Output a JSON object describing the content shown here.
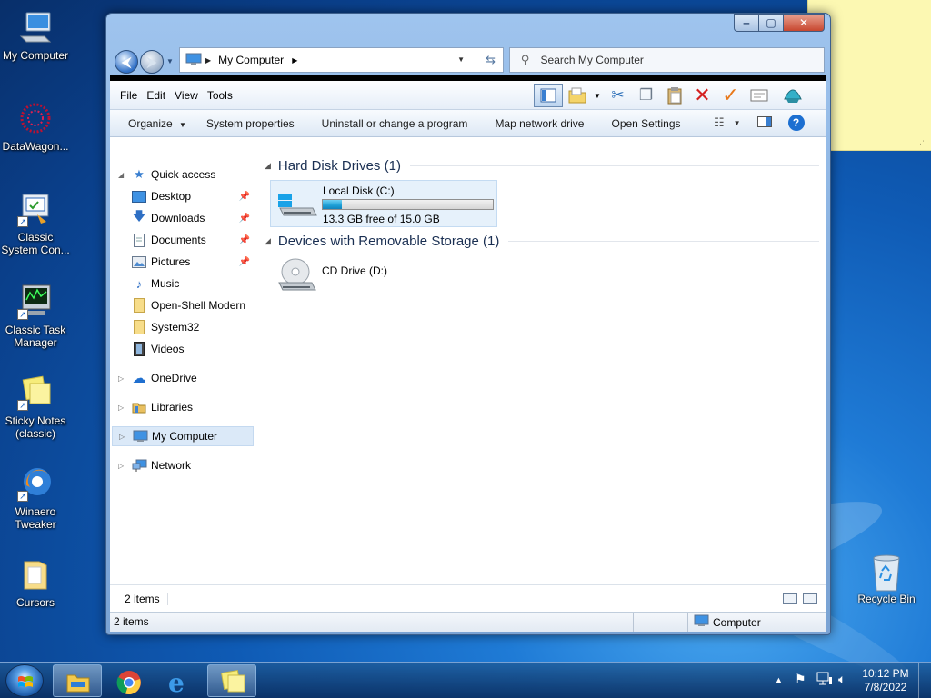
{
  "desktop": {
    "icons": [
      {
        "label": "My Computer"
      },
      {
        "label": "DataWagon..."
      },
      {
        "label": "Classic System Con..."
      },
      {
        "label": "Classic Task Manager"
      },
      {
        "label": "Sticky Notes (classic)"
      },
      {
        "label": "Winaero Tweaker"
      },
      {
        "label": "Cursors"
      },
      {
        "label": "Recycle Bin"
      }
    ]
  },
  "window": {
    "caption_buttons": {
      "minimize": "‒",
      "maximize": "▢",
      "close": "✕"
    },
    "address": {
      "location": "My Computer"
    },
    "search": {
      "placeholder": "Search My Computer"
    },
    "menu": [
      "File",
      "Edit",
      "View",
      "Tools"
    ],
    "commands": [
      "Organize",
      "System properties",
      "Uninstall or change a program",
      "Map network drive",
      "Open Settings"
    ],
    "help": "?",
    "nav": {
      "quick_access": "Quick access",
      "items": [
        "Desktop",
        "Downloads",
        "Documents",
        "Pictures",
        "Music",
        "Open-Shell Modern",
        "System32",
        "Videos"
      ],
      "onedrive": "OneDrive",
      "libraries": "Libraries",
      "my_computer": "My Computer",
      "network": "Network"
    },
    "groups": {
      "hdd": "Hard Disk Drives (1)",
      "removable": "Devices with Removable Storage (1)"
    },
    "drives": {
      "c": {
        "name": "Local Disk (C:)",
        "free": "13.3 GB free of 15.0 GB",
        "used_fraction": 0.113
      },
      "d": {
        "name": "CD Drive (D:)"
      }
    },
    "status": {
      "items_inner": "2 items",
      "items_bar": "2 items",
      "location": "Computer"
    }
  },
  "taskbar": {
    "time": "10:12 PM",
    "date": "7/8/2022"
  },
  "colors": {
    "accent": "#1c6fd1",
    "capacity_fill": "#1d9fd6",
    "close": "#c7472f"
  }
}
